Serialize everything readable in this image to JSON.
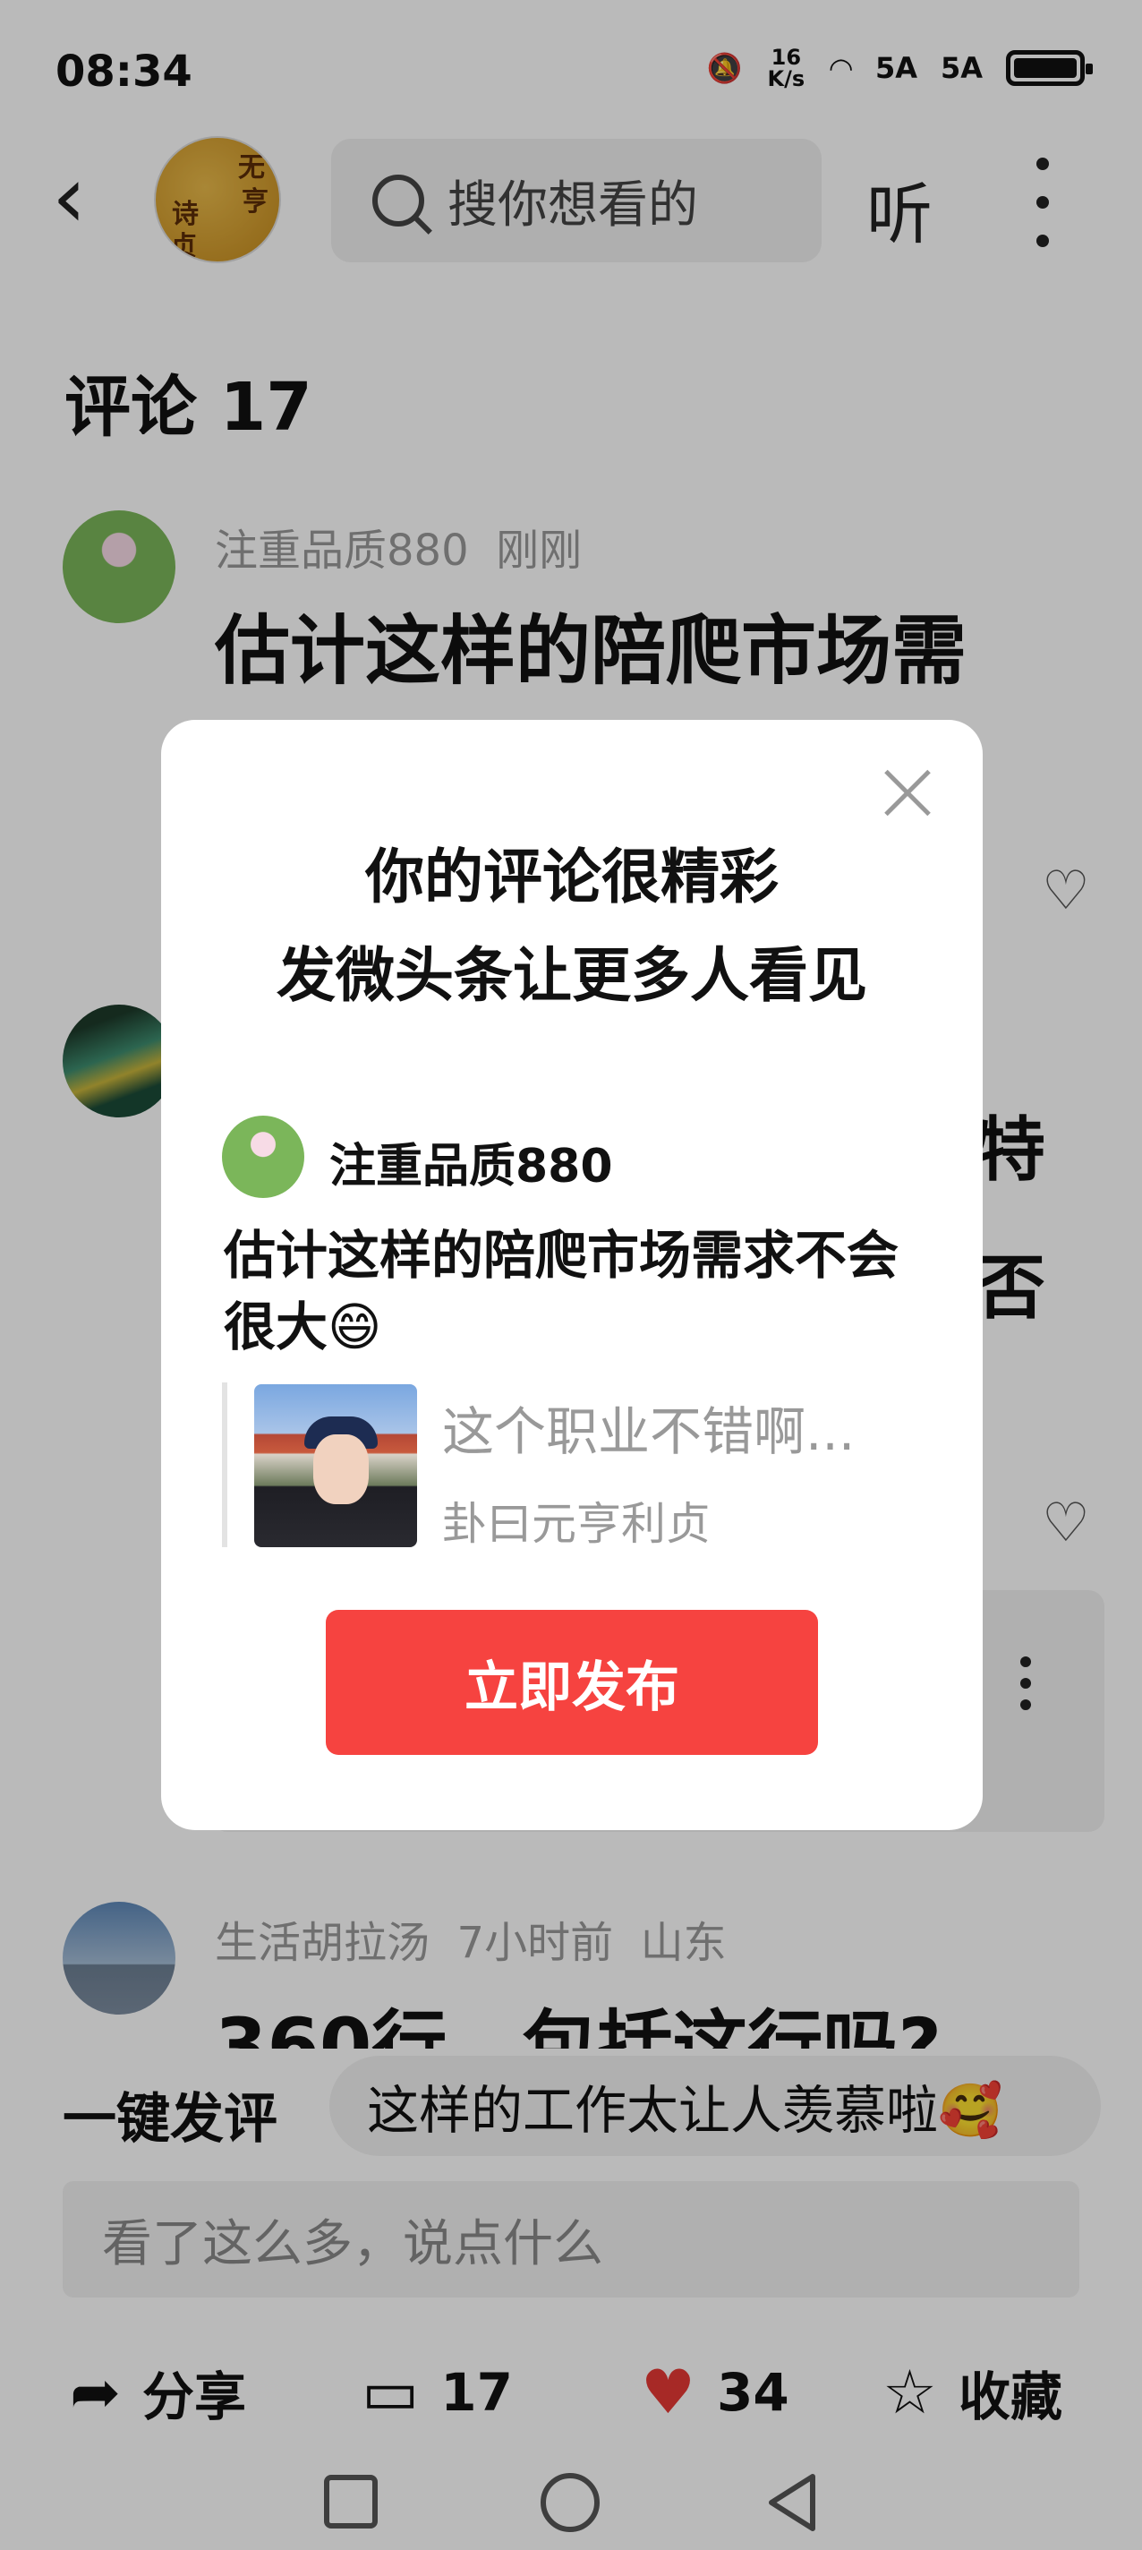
{
  "status_bar": {
    "time": "08:34",
    "net_speed": "16 K/s",
    "sim1": "5A",
    "sim2": "5A"
  },
  "top_bar": {
    "search_placeholder": "搜你想看的",
    "listen_label": "听"
  },
  "comments": {
    "title": "评论 17",
    "items": [
      {
        "user": "注重品质880",
        "time": "刚刚",
        "text": "估计这样的陪爬市场需"
      },
      {
        "user": "",
        "time": "",
        "text_right_1": "特",
        "text_right_2": "否"
      },
      {
        "user": "生活胡拉汤",
        "time": "7小时前",
        "location": "山东",
        "text": "360行，包括这行吗?"
      }
    ]
  },
  "quick_reply": {
    "label": "一键发评",
    "chip": "这样的工作太让人羡慕啦🥰"
  },
  "input": {
    "placeholder": "看了这么多，说点什么"
  },
  "actions": {
    "share": "分享",
    "comments_count": "17",
    "likes_count": "34",
    "favorite": "收藏"
  },
  "dialog": {
    "title_line1": "你的评论很精彩",
    "title_line2": "发微头条让更多人看见",
    "user": "注重品质880",
    "text": "估计这样的陪爬市场需求不会很大😄",
    "quote_title": "这个职业不错啊...",
    "quote_author": "卦曰元亨利贞",
    "publish_button": "立即发布"
  },
  "colors": {
    "accent": "#f64340",
    "like": "#e53935"
  }
}
